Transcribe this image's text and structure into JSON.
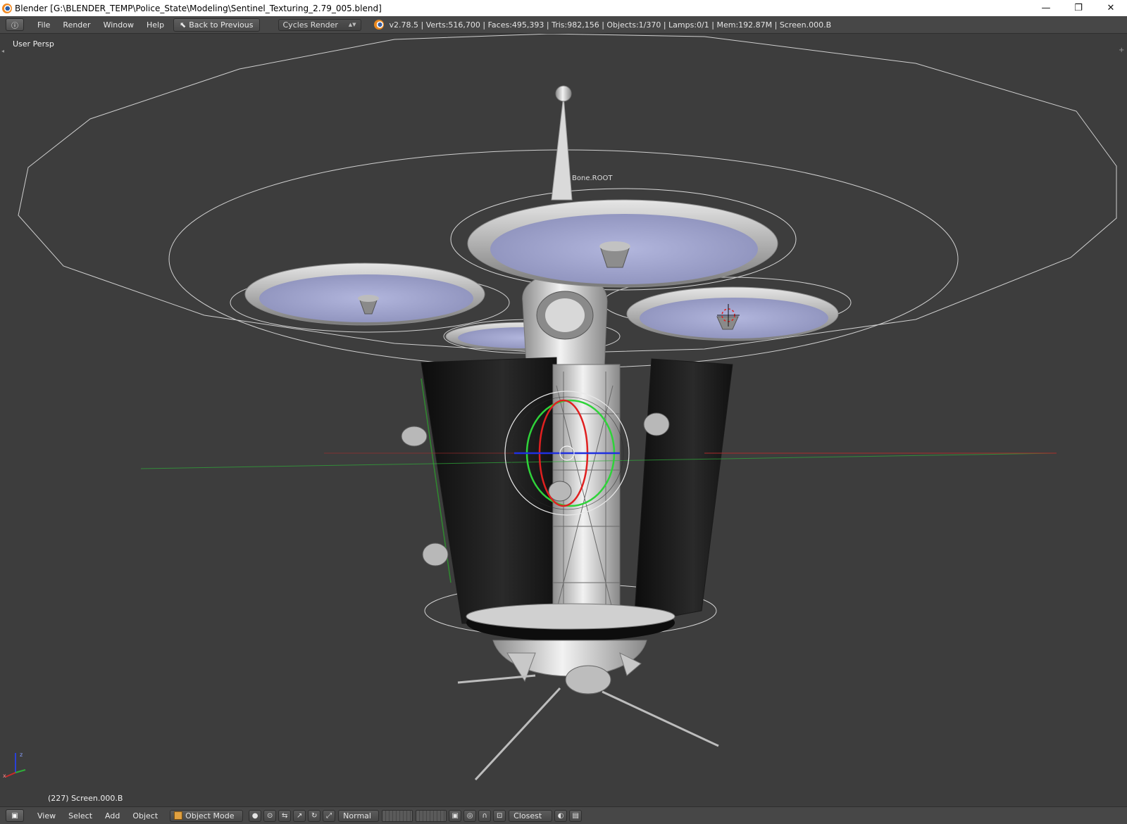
{
  "window": {
    "title": "Blender [G:\\BLENDER_TEMP\\Police_State\\Modeling\\Sentinel_Texturing_2.79_005.blend]",
    "minimize_glyph": "—",
    "restore_glyph": "❐",
    "close_glyph": "✕"
  },
  "info_header": {
    "editor_icon": "ⓘ",
    "menus": [
      "File",
      "Render",
      "Window",
      "Help"
    ],
    "back_button": "Back to Previous",
    "render_engine": "Cycles Render",
    "stats": "v2.78.5 | Verts:516,700 | Faces:495,393 | Tris:982,156 | Objects:1/370 | Lamps:0/1 | Mem:192.87M | Screen.000.B"
  },
  "viewport": {
    "view_name": "User Persp",
    "object_info": "(227) Screen.000.B",
    "bone_label": "Bone.ROOT",
    "axis_labels": {
      "z": "z",
      "x": "x"
    }
  },
  "view3d_header": {
    "editor_icon": "▣",
    "menus": [
      "View",
      "Select",
      "Add",
      "Object"
    ],
    "mode": "Object Mode",
    "pivot": "Normal",
    "snap": "Closest"
  },
  "colors": {
    "viewport_bg": "#3d3d3d",
    "header_bg": "#474747",
    "axis_x": "#cc2a2a",
    "axis_y": "#2fae3a",
    "axis_z": "#2a40d8",
    "propeller_fill": "#a3a7cf"
  },
  "icons": [
    "info-icon",
    "back-arrow-icon",
    "blender-logo-icon",
    "editor-type-icon",
    "object-mode-cube-icon",
    "viewport-shading-icon",
    "pivot-icon",
    "manipulator-icon",
    "translate-icon",
    "rotate-icon",
    "scale-icon",
    "layers-grid-icon",
    "lock-icon",
    "proportional-edit-icon",
    "snap-icon",
    "render-icon",
    "opengl-render-icon"
  ]
}
